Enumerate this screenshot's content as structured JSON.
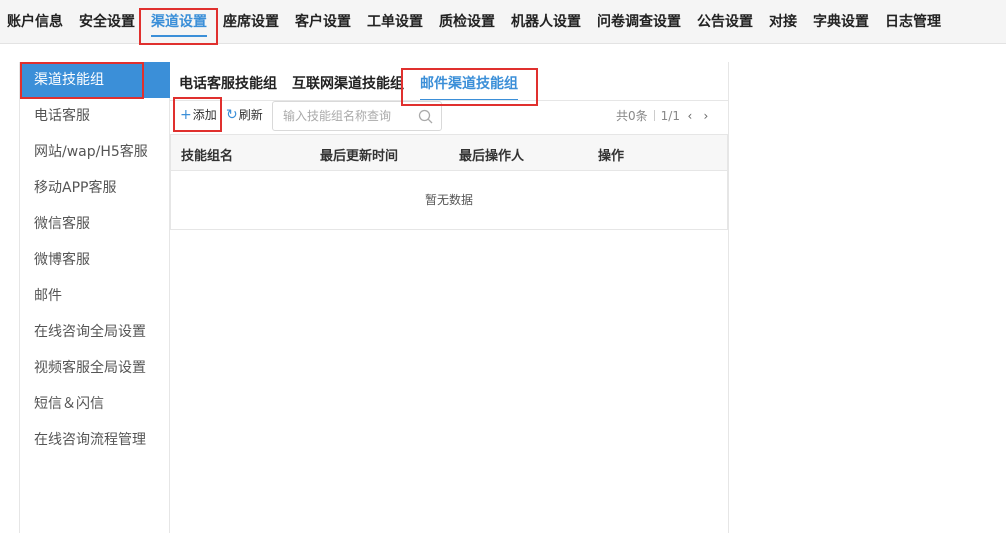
{
  "topnav": {
    "items": [
      {
        "label": "账户信息"
      },
      {
        "label": "安全设置"
      },
      {
        "label": "渠道设置"
      },
      {
        "label": "座席设置"
      },
      {
        "label": "客户设置"
      },
      {
        "label": "工单设置"
      },
      {
        "label": "质检设置"
      },
      {
        "label": "机器人设置"
      },
      {
        "label": "问卷调查设置"
      },
      {
        "label": "公告设置"
      },
      {
        "label": "对接"
      },
      {
        "label": "字典设置"
      },
      {
        "label": "日志管理"
      }
    ],
    "active": "渠道设置"
  },
  "sidebar": {
    "items": [
      {
        "label": "渠道技能组"
      },
      {
        "label": "电话客服"
      },
      {
        "label": "网站/wap/H5客服"
      },
      {
        "label": "移动APP客服"
      },
      {
        "label": "微信客服"
      },
      {
        "label": "微博客服"
      },
      {
        "label": "邮件"
      },
      {
        "label": "在线咨询全局设置"
      },
      {
        "label": "视频客服全局设置"
      },
      {
        "label": "短信＆闪信"
      },
      {
        "label": "在线咨询流程管理"
      }
    ],
    "active": "渠道技能组"
  },
  "tabs": {
    "items": [
      {
        "label": "电话客服技能组"
      },
      {
        "label": "互联网渠道技能组"
      },
      {
        "label": "邮件渠道技能组"
      }
    ],
    "active": "邮件渠道技能组"
  },
  "toolbar": {
    "add_label": "添加",
    "refresh_label": "刷新",
    "search_placeholder": "输入技能组名称查询"
  },
  "pager": {
    "total": "共0条",
    "page": "1/1"
  },
  "table": {
    "columns": [
      "技能组名",
      "最后更新时间",
      "最后操作人",
      "操作"
    ],
    "empty_text": "暂无数据"
  },
  "colors": {
    "accent": "#3b8fd8",
    "highlight_box": "#e0302e"
  },
  "icons": {
    "add": "plus-icon",
    "refresh": "refresh-icon",
    "search": "search-icon",
    "prev": "chevron-left-icon",
    "next": "chevron-right-icon"
  }
}
